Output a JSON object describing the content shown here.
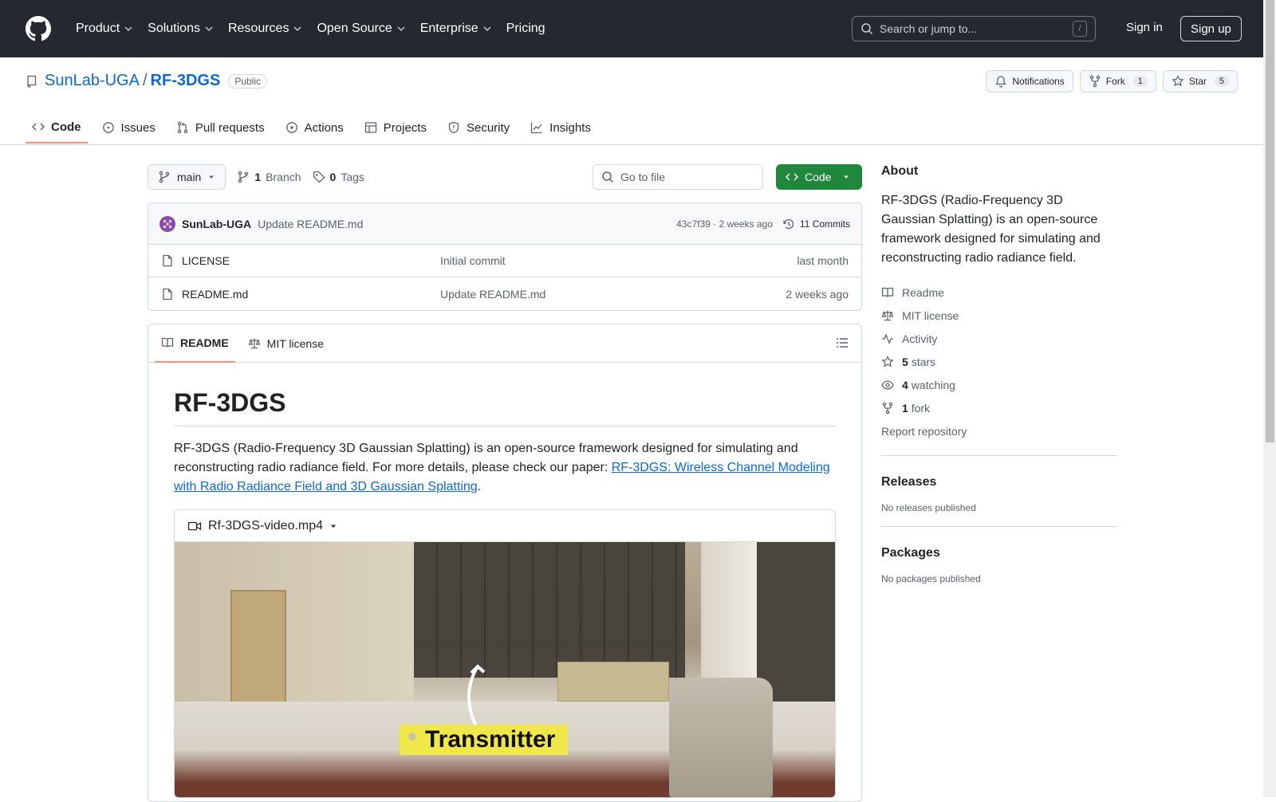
{
  "header": {
    "nav": [
      "Product",
      "Solutions",
      "Resources",
      "Open Source",
      "Enterprise",
      "Pricing"
    ],
    "search_placeholder": "Search or jump to...",
    "search_shortcut": "/",
    "sign_in": "Sign in",
    "sign_up": "Sign up"
  },
  "repo": {
    "owner": "SunLab-UGA",
    "separator": "/",
    "name": "RF-3DGS",
    "visibility": "Public",
    "notifications_label": "Notifications",
    "fork_label": "Fork",
    "fork_count": "1",
    "star_label": "Star",
    "star_count": "5"
  },
  "tabs": [
    "Code",
    "Issues",
    "Pull requests",
    "Actions",
    "Projects",
    "Security",
    "Insights"
  ],
  "toolbar": {
    "branch": "main",
    "branch_count": "1",
    "branch_label": "Branch",
    "tag_count": "0",
    "tag_label": "Tags",
    "goto_placeholder": "Go to file",
    "code_button": "Code"
  },
  "latest_commit": {
    "author": "SunLab-UGA",
    "message": "Update README.md",
    "hash_time": "43c7f39 · 2 weeks ago",
    "commits_label": "11 Commits"
  },
  "files": [
    {
      "name": "LICENSE",
      "message": "Initial commit",
      "date": "last month"
    },
    {
      "name": "README.md",
      "message": "Update README.md",
      "date": "2 weeks ago"
    }
  ],
  "readme": {
    "tab_readme": "README",
    "tab_license": "MIT license",
    "title": "RF-3DGS",
    "paragraph_text": "RF-3DGS (Radio-Frequency 3D Gaussian Splatting) is an open-source framework designed for simulating and reconstructing radio radiance field. For more details, please check our paper: ",
    "paper_link": "RF-3DGS: Wireless Channel Modeling with Radio Radiance Field and 3D Gaussian Splatting",
    "paragraph_end": ".",
    "video_name": "Rf-3DGS-video.mp4",
    "video_overlay_label": "Transmitter"
  },
  "sidebar": {
    "about_title": "About",
    "about_description": "RF-3DGS (Radio-Frequency 3D Gaussian Splatting) is an open-source framework designed for simulating and reconstructing radio radiance field.",
    "readme": "Readme",
    "license": "MIT license",
    "activity": "Activity",
    "stars_count": "5",
    "stars_label": "stars",
    "watching_count": "4",
    "watching_label": "watching",
    "fork_count": "1",
    "fork_label": "fork",
    "report": "Report repository",
    "releases_title": "Releases",
    "releases_text": "No releases published",
    "packages_title": "Packages",
    "packages_text": "No packages published"
  },
  "colors": {
    "header_bg": "#24292f",
    "link": "#0969da",
    "code_button": "#1f883d",
    "tab_underline": "#fd8c73"
  }
}
